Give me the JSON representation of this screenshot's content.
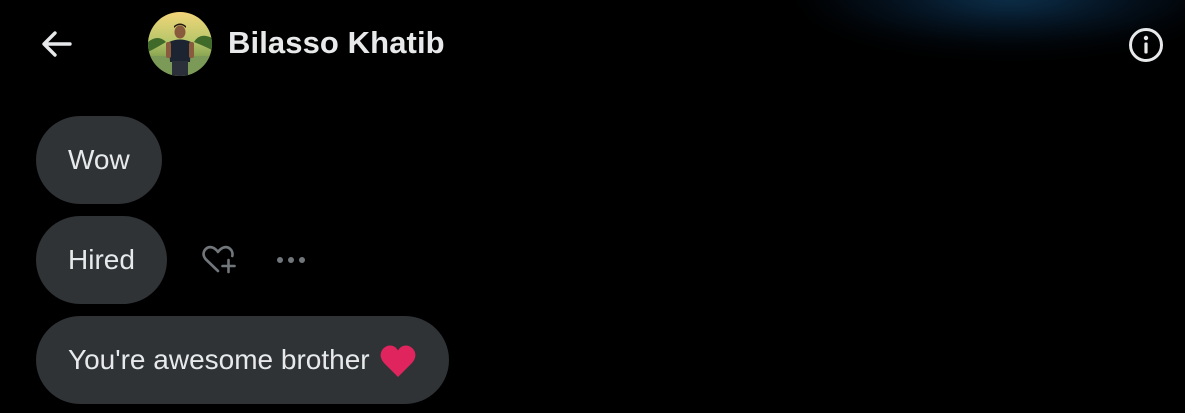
{
  "header": {
    "contact_name": "Bilasso Khatib",
    "back_icon": "arrow-left-icon",
    "info_icon": "info-circle-icon"
  },
  "messages": [
    {
      "text": "Wow"
    },
    {
      "text": "Hired"
    },
    {
      "text": "You're awesome brother",
      "emoji": "red-heart"
    }
  ],
  "message_actions": {
    "react_icon": "heart-plus-icon",
    "more_icon": "more-horizontal-icon"
  },
  "colors": {
    "background": "#000000",
    "bubble": "#2f3336",
    "text": "#e7e9ea",
    "heart": "#e0245e",
    "action_icon": "#71767b"
  }
}
